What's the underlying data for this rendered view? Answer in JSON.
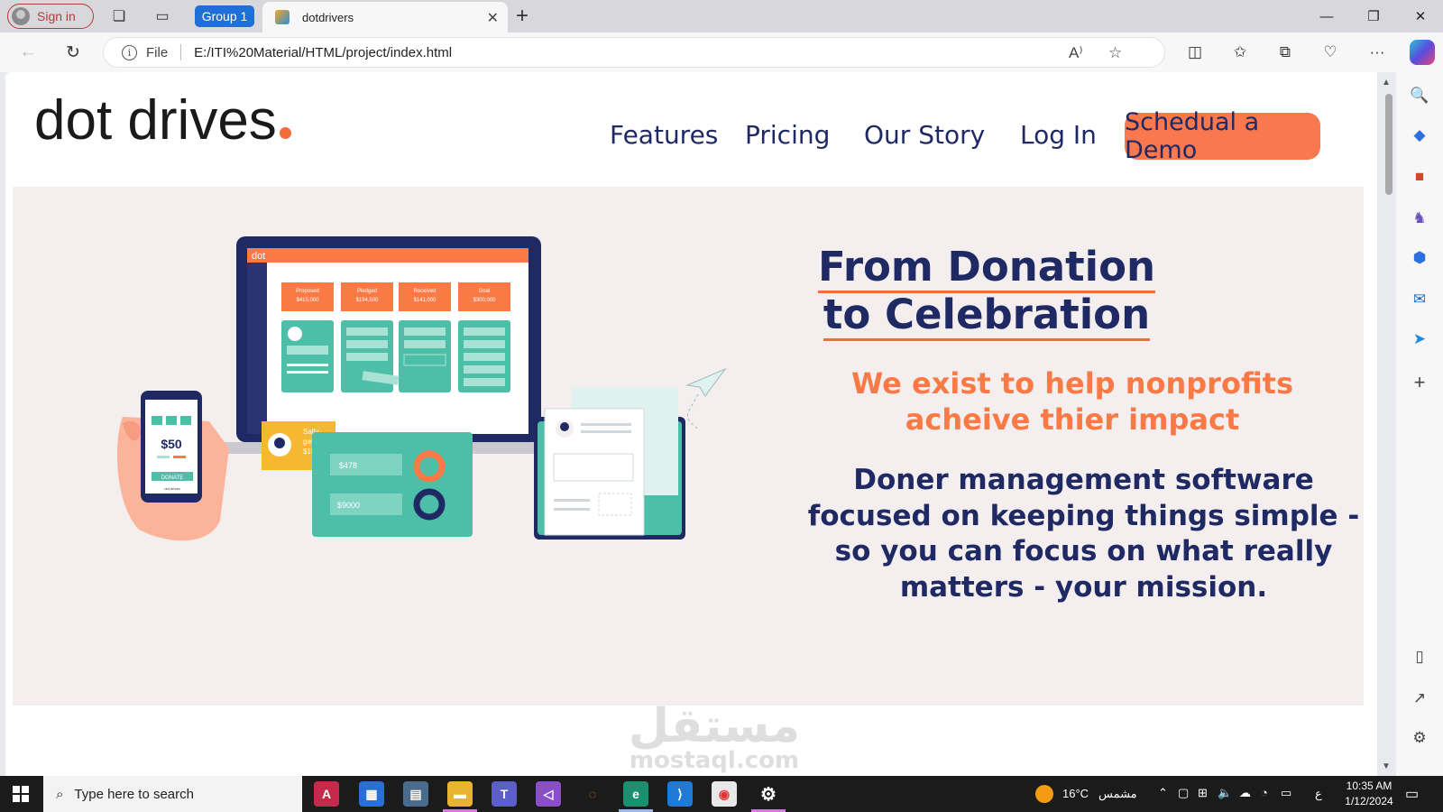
{
  "browser": {
    "sign_in": "Sign in",
    "group_label": "Group 1",
    "tab_title": "dotdrivers",
    "address_scheme": "File",
    "address_url": "E:/ITI%20Material/HTML/project/index.html"
  },
  "site": {
    "logo_text": "dot drives",
    "nav": [
      "Features",
      "Pricing",
      "Our Story",
      "Log In"
    ],
    "cta": "Schedual a Demo"
  },
  "hero": {
    "title": "From Donation to Celebration",
    "subtitle": "We exist to help nonprofits acheive thier impact",
    "description": "Doner management software focused on keeping things simple - so you can focus on what really matters - your mission.",
    "illustration": {
      "brand": "dot",
      "stats": [
        {
          "label": "Proposed",
          "value": "$415,000"
        },
        {
          "label": "Pledged",
          "value": "$194,500"
        },
        {
          "label": "Received",
          "value": "$141,000"
        },
        {
          "label": "Goal",
          "value": "$300,000"
        }
      ],
      "phone_amount": "$50",
      "phone_button": "DONATE",
      "phone_footer": "dot drives",
      "gift_note": "Sally gave $150",
      "tablet_values": [
        "$478",
        "$9000"
      ]
    }
  },
  "watermark": {
    "main": "مستقل",
    "sub": "mostaql.com"
  },
  "taskbar": {
    "search_placeholder": "Type here to search",
    "weather": "16°C",
    "weather_label": "مشمس",
    "lang": "ع",
    "time": "10:35 AM",
    "date": "1/12/2024"
  },
  "colors": {
    "accent_orange": "#f97a45",
    "navy": "#1f2a64",
    "teal": "#4dbfa8",
    "hero_bg": "#f4efee"
  }
}
